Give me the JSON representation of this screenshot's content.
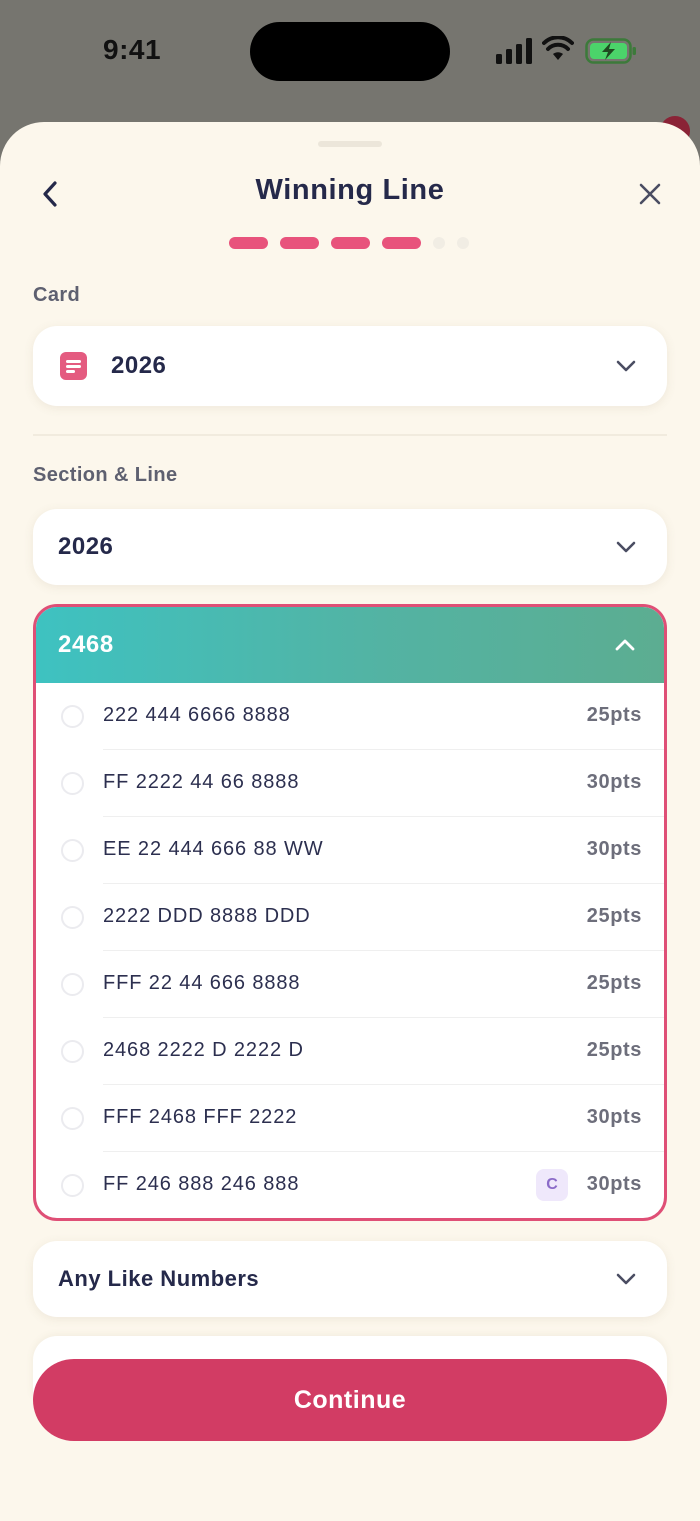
{
  "status_bar": {
    "time": "9:41"
  },
  "header": {
    "title": "Winning Line",
    "progress": {
      "total": 6,
      "completed": 4
    }
  },
  "card_field": {
    "label": "Card",
    "value": "2026"
  },
  "section_field": {
    "label": "Section & Line",
    "value": "2026"
  },
  "expanded_group": {
    "title": "2468",
    "options": [
      {
        "text": "222 444 6666 8888",
        "points": "25pts"
      },
      {
        "text": "FF 2222 44 66 8888",
        "points": "30pts"
      },
      {
        "text": "EE 22 444 666 88 WW",
        "points": "30pts"
      },
      {
        "text": "2222 DDD 8888 DDD",
        "points": "25pts"
      },
      {
        "text": "FFF 22 44 666 8888",
        "points": "25pts"
      },
      {
        "text": "2468 2222 D 2222 D",
        "points": "25pts"
      },
      {
        "text": "FFF 2468 FFF 2222",
        "points": "30pts"
      },
      {
        "text": "FF 246 888 246 888",
        "points": "30pts",
        "badge": "C"
      }
    ]
  },
  "collapsed_group": {
    "title": "Any Like Numbers"
  },
  "footer": {
    "continue_label": "Continue"
  },
  "colors": {
    "accent": "#d23c64",
    "progress": "#e8537c",
    "header_gradient_start": "#3ec2c1",
    "header_gradient_end": "#5cad91"
  }
}
